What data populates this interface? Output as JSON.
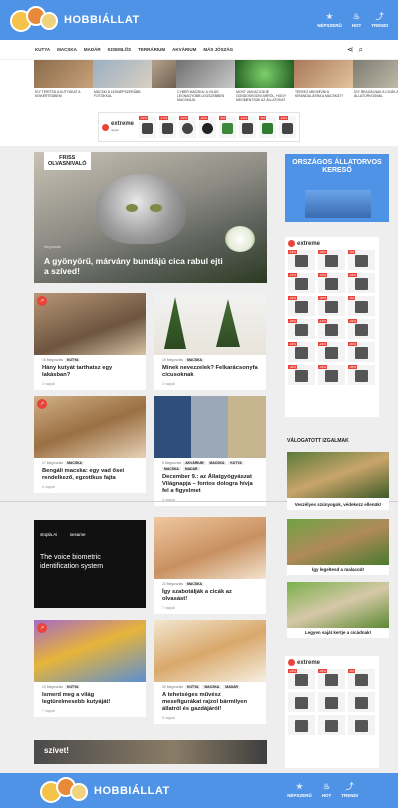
{
  "header": {
    "brand": "HOBBIÁLLAT",
    "nav": [
      {
        "label": "NÉPSZERŰ",
        "icon": "star-icon"
      },
      {
        "label": "HOT",
        "icon": "flame-icon"
      },
      {
        "label": "TRENDI",
        "icon": "trend-icon"
      }
    ]
  },
  "categories": [
    "KUTYA",
    "MACSKA",
    "MADÁR",
    "KISEMLŐS",
    "TERRÁRIUM",
    "AKVÁRIUM",
    "MÁS JÓSZÁG"
  ],
  "ticker": [
    {
      "caption": "ÍGY TERÍTSD A KUTYÁKAT A KISKERTEDBEN!"
    },
    {
      "caption": "MACSKI A LEGNÉPSZERŰBB FOTÓKKAL"
    },
    {
      "caption": ""
    },
    {
      "caption": "CYBER MACSKA: A VILÁG LEGNAGYOBB LEGSZEBBEN MACSKÁJA"
    },
    {
      "caption": "MOST VAN AZ IDEJE GONDOSKODNI ARRÓL, HOGY MEGMENTSÜK AZ ÁLLATOKAT"
    },
    {
      "caption": "TERVEZ MEGHÍVNI A KÍRÁNDULÁSRA A MACSKÁT?"
    },
    {
      "caption": "ÍGY REAGÁLNAK A CICÁK AZ ÁLLATORVOSNÁL"
    }
  ],
  "ad": {
    "brand": "extreme",
    "brand_sub": "digital",
    "discounts": [
      "-16%",
      "-17%",
      "-10%",
      "-20%",
      "-6%",
      "-14%",
      "-5%",
      "-19%",
      "-10%"
    ]
  },
  "hero": {
    "badge_line1": "FRISS",
    "badge_line2": "OLVASNIVALÓ",
    "meta": "Megosztás",
    "title": "A gyönyörű, márvány bundájú cica rabul ejti a szíved!"
  },
  "cards": [
    {
      "shares": "16 Megosztás",
      "tags": [
        "KUTYA"
      ],
      "title": "Hány kutyát tarthatsz egy lakásban?",
      "date": "3 nappal"
    },
    {
      "shares": "19 Megosztás",
      "tags": [
        "MACSKA"
      ],
      "title": "Minek nevezzelek? Felkarácsonyfa cicusoknak",
      "date": "3 nappal"
    },
    {
      "shares": "17 Megosztás",
      "tags": [
        "MACSKA"
      ],
      "title": "Bengáli macska: egy vad ősei rendelkező, egzotikus fajta",
      "date": "6 nappal"
    },
    {
      "shares": "8 Megosztás",
      "tags": [
        "AKVÁRIUM",
        "MACSKA",
        "KUTYA",
        "MACSKA",
        "MADÁR"
      ],
      "title": "December 9.: az Állatgyógyászat Világnapja – fontos dologra hívja fel a figyelmet",
      "date": "5 nappal"
    },
    {
      "shares": "",
      "tags": [],
      "title": "",
      "date": ""
    },
    {
      "shares": "22 Megosztás",
      "tags": [
        "MACSKA"
      ],
      "title": "Így szabotálják a cicák az olvasást!",
      "date": "7 nappal"
    },
    {
      "shares": "10 Megosztás",
      "tags": [
        "KUTYA"
      ],
      "title": "Ismerd meg a világ legtürelmesebb kutyáját!",
      "date": "7 nappal"
    },
    {
      "shares": "30 Megosztás",
      "tags": [
        "KUTYA",
        "MACSKA",
        "MADÁR"
      ],
      "title": "A tehetséges művész mesefigurákat rajzol bármilyen állatról és gazdájáról!",
      "date": "8 nappal"
    }
  ],
  "ad_block": {
    "lines": [
      "stopla.Ai",
      "sesame",
      "The voice biometric identification system"
    ]
  },
  "sidebar": {
    "search_title": "ORSZÁGOS ÁLLATORVOS KERESŐ",
    "section_title": "VÁLOGATOTT IZGALMAK",
    "stories": [
      {
        "caption": ""
      },
      {
        "caption": "Veszélyes szúnyogok, védekezz ellenük!"
      },
      {
        "caption": "Így legeltesd a malacod!"
      },
      {
        "caption": "Legyen saját kertje a cicádnak!"
      }
    ],
    "ad_discounts": [
      "-19%",
      "-29%",
      "-5%",
      "-27%",
      "-10%",
      "-34%",
      "-21%",
      "-30%",
      "-9%",
      "-23%",
      "-14%",
      "-31%",
      "-16%",
      "-24%",
      "-30%",
      "-44%",
      "-16%",
      "-35%",
      "-23%",
      "-26%",
      "-9%"
    ]
  },
  "bottom_strip": "szívet!",
  "footer": {
    "brand": "HOBBIÁLLAT"
  },
  "colors": {
    "brand_blue": "#4f93e6",
    "badge_red": "#e8443a"
  }
}
